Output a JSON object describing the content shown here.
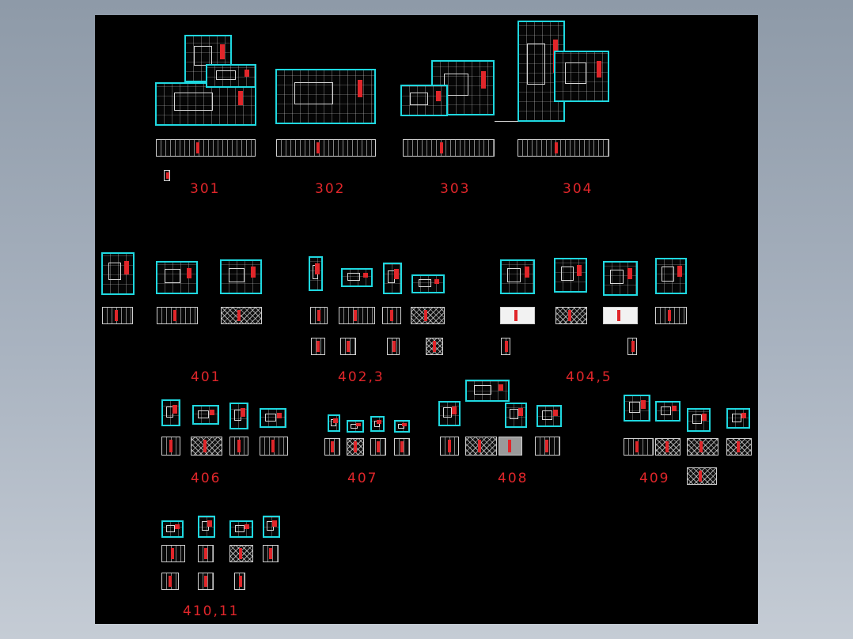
{
  "sheet": {
    "background_color": "#000000",
    "plan_line_color": "#1fd8e0",
    "accent_color": "#e0262a",
    "detail_color": "#d8d8d8"
  },
  "labels": {
    "l301": "301",
    "l302": "302",
    "l303": "303",
    "l304": "304",
    "l401": "401",
    "l4023": "402,3",
    "l4045": "404,5",
    "l406": "406",
    "l407": "407",
    "l408": "408",
    "l409": "409",
    "l41011": "410,11"
  }
}
